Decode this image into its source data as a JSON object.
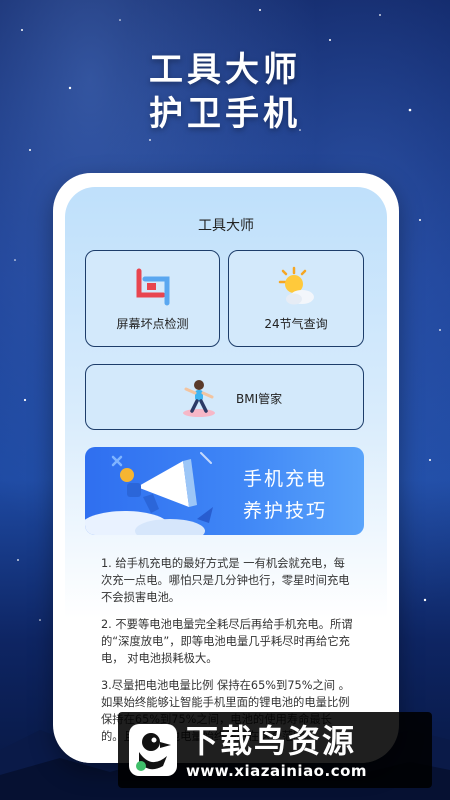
{
  "promo": {
    "headline_line1": "工具大师",
    "headline_line2": "护卫手机"
  },
  "app": {
    "title": "工具大师",
    "tools": [
      {
        "label": "屏幕坏点检测",
        "icon": "screen-frame-icon"
      },
      {
        "label": "24节气查询",
        "icon": "sun-cloud-icon"
      },
      {
        "label": "BMI管家",
        "icon": "fitness-person-icon"
      }
    ],
    "banner": {
      "line1": "手机充电",
      "line2": "养护技巧",
      "icon": "megaphone-icon"
    },
    "article": [
      "1. 给手机充电的最好方式是 一有机会就充电，每次充一点电。哪怕只是几分钟也行，零星时间充电不会损害电池。",
      "2. 不要等电池电量完全耗尽后再给手机充电。所谓的“深度放电”，即等电池电量几乎耗尽时再给它充电， 对电池损耗极大。",
      "3.尽量把电池电量比例 保持在65%到75%之间 。如果始终能够让智能手机里面的锂电池的电量比例保持在65%到75%之间，电池的使用寿命最长的。且能让电池电量始终保持在这个范围。"
    ]
  },
  "watermark": {
    "brand": "下载鸟资源",
    "url": "www.xiazainiao.com",
    "icon": "bird-logo-icon"
  },
  "colors": {
    "background_top": "#0b1f5e",
    "card_fill": "#d3e9fb",
    "card_border": "#1d3d6a",
    "banner_blue": "#2f6ff0"
  }
}
